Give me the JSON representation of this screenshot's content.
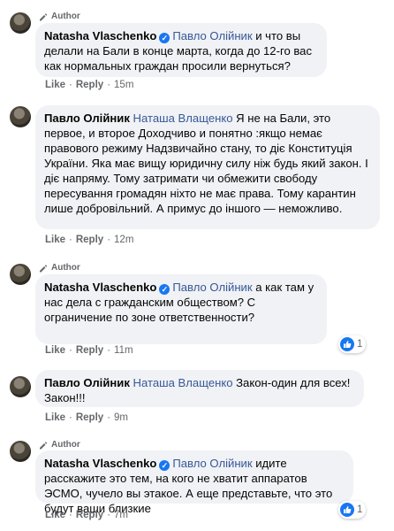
{
  "comments": [
    {
      "author_badge": "Author",
      "name": "Natasha Vlaschenko",
      "mention": "Павло Олійник",
      "text": " и что вы делали на Бали в конце марта, когда до 12-го вас как нормальных граждан просили вернуться?",
      "like": "Like",
      "reply": "Reply",
      "time": "15m"
    },
    {
      "name": "Павло Олійник",
      "mention": "Наташа Влащенко",
      "text": " Я не на Бали, это первое, и второе Доходчиво и понятно :якщо немає правового режиму Надзвичайно стану, то діє Конституція України. Яка має вищу юридичну силу ніж будь який закон. І діє напряму. Тому затримати чи обмежити свободу пересування громадян ніхто не має права. Тому карантин лише добровільний. А примус до іншого — неможливо.",
      "like": "Like",
      "reply": "Reply",
      "time": "12m"
    },
    {
      "author_badge": "Author",
      "name": "Natasha Vlaschenko",
      "mention": "Павло Олійник",
      "text": " а как там у нас дела с гражданским обществом? С ограничение по зоне ответственности?",
      "like": "Like",
      "reply": "Reply",
      "time": "11m",
      "reactions": "1"
    },
    {
      "name": "Павло Олійник",
      "mention": "Наташа Влащенко",
      "text": " Закон-один для всех! Закон!!!",
      "like": "Like",
      "reply": "Reply",
      "time": "9m"
    },
    {
      "author_badge": "Author",
      "name": "Natasha Vlaschenko",
      "mention": "Павло Олійник",
      "text": " идите расскажите это тем, на кого не хватит аппаратов ЭСМО, чучело вы этакое. А еще представьте, что это будут ваши близкие",
      "like": "Like",
      "reply": "Reply",
      "time": "7m",
      "reactions": "1"
    }
  ],
  "colors": {
    "bubble": "#f0f2f5",
    "mention": "#385898",
    "meta": "#65676b",
    "accent": "#1877f2"
  }
}
